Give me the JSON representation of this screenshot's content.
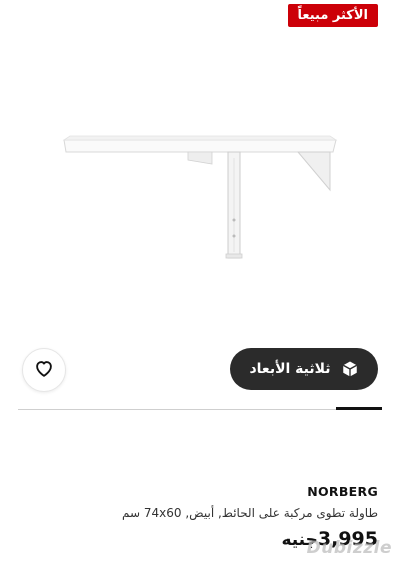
{
  "badge": {
    "label": "الأكثر مبيعاً",
    "color": "#cc0008"
  },
  "actions": {
    "favorite_icon": "heart-icon",
    "view_3d_label": "ثلاثية الأبعاد",
    "view_3d_icon": "cube-3d-icon"
  },
  "product": {
    "brand": "NORBERG",
    "description": "طاولة تطوى مركبة على الحائط, أبيض, 74x60 سم",
    "price": "3,995",
    "currency": "جنيه"
  },
  "watermark": {
    "text": "Dubizzle"
  }
}
